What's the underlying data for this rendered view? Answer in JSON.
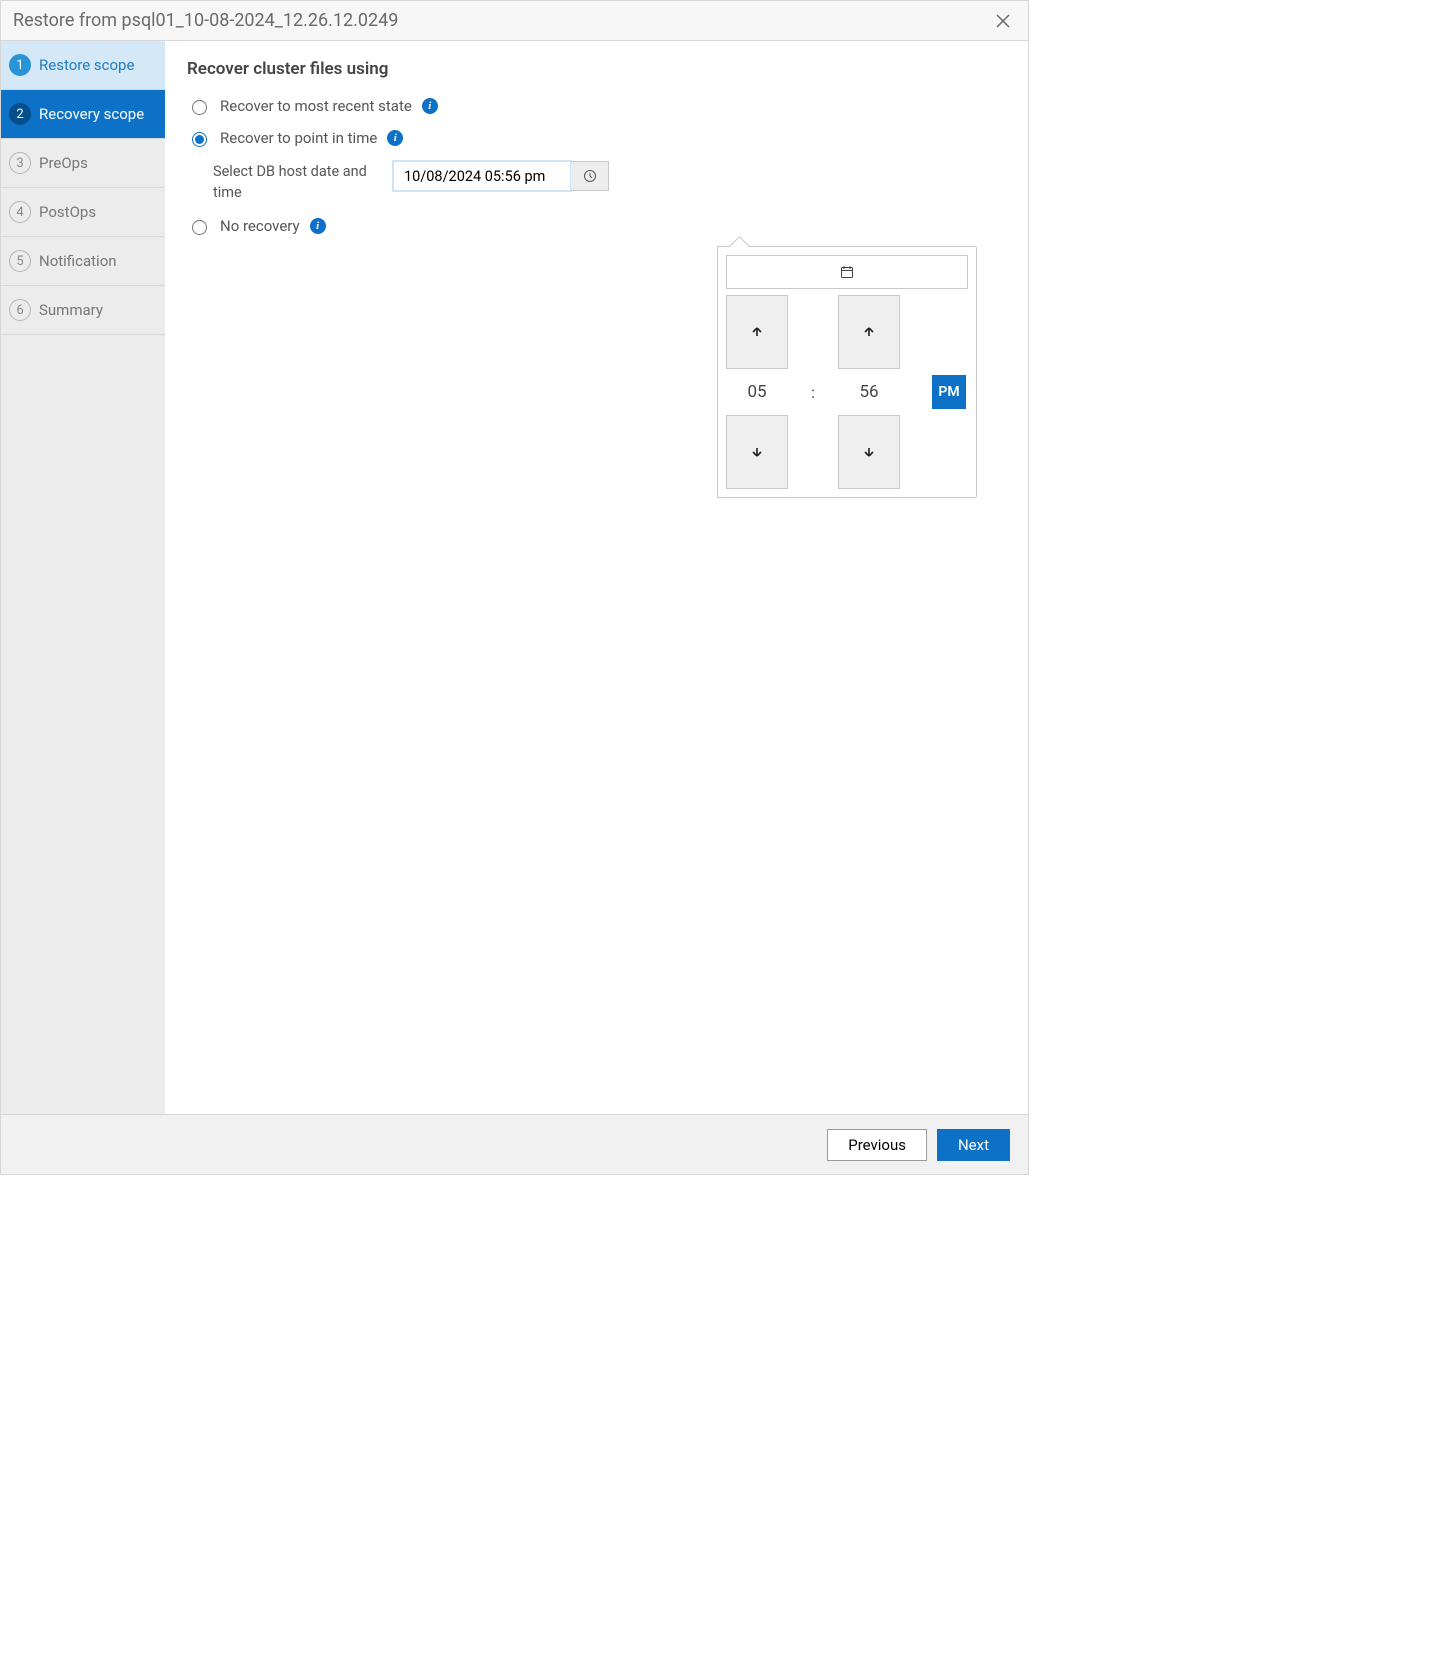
{
  "header": {
    "title": "Restore from psql01_10-08-2024_12.26.12.0249"
  },
  "steps": [
    {
      "num": "1",
      "label": "Restore scope",
      "state": "done"
    },
    {
      "num": "2",
      "label": "Recovery scope",
      "state": "active"
    },
    {
      "num": "3",
      "label": "PreOps",
      "state": ""
    },
    {
      "num": "4",
      "label": "PostOps",
      "state": ""
    },
    {
      "num": "5",
      "label": "Notification",
      "state": ""
    },
    {
      "num": "6",
      "label": "Summary",
      "state": ""
    }
  ],
  "main": {
    "heading": "Recover cluster files using",
    "options": {
      "recent": "Recover to most recent state",
      "pit": "Recover to point in time",
      "none": "No recovery"
    },
    "selected": "pit",
    "pit": {
      "label": "Select DB host date and time",
      "value": "10/08/2024 05:56 pm"
    }
  },
  "picker": {
    "hour": "05",
    "minute": "56",
    "ampm": "PM",
    "colon": ":"
  },
  "footer": {
    "prev": "Previous",
    "next": "Next"
  }
}
